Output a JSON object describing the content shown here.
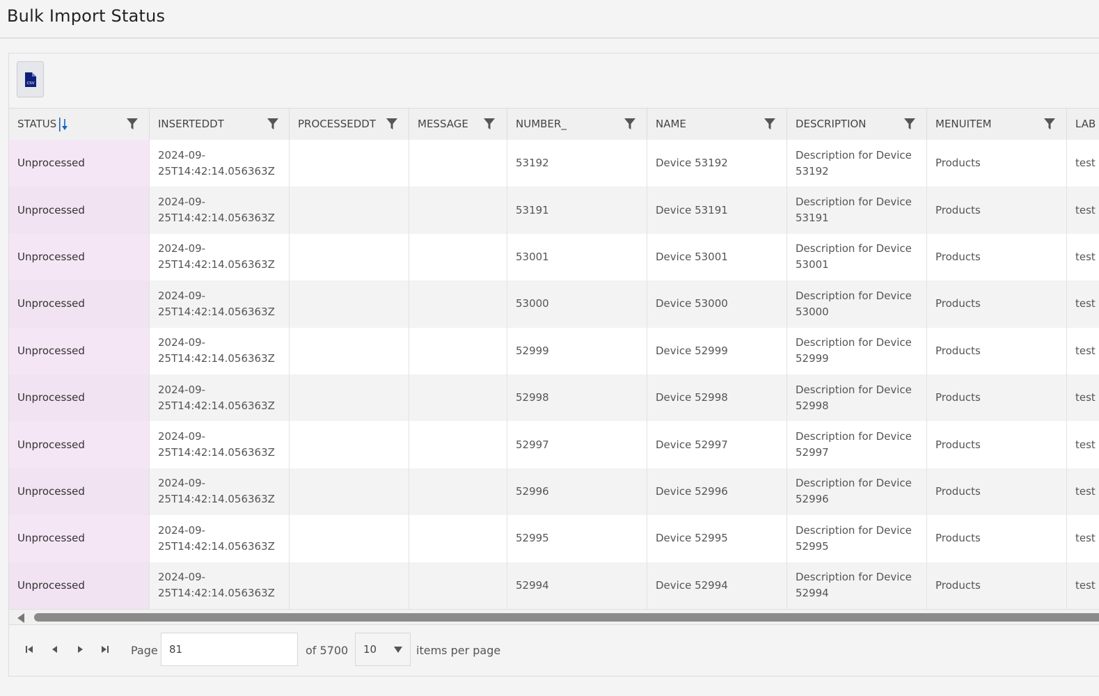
{
  "page": {
    "title": "Bulk Import Status"
  },
  "toolbar": {
    "export_icon": "csv-file-icon",
    "export_icon_text": "CSV"
  },
  "columns": [
    {
      "key": "status",
      "label": "STATUS",
      "sorted": "descending"
    },
    {
      "key": "inserteddt",
      "label": "INSERTEDDT"
    },
    {
      "key": "processeddt",
      "label": "PROCESSEDDT"
    },
    {
      "key": "message",
      "label": "MESSAGE"
    },
    {
      "key": "number",
      "label": "NUMBER_"
    },
    {
      "key": "name",
      "label": "NAME"
    },
    {
      "key": "description",
      "label": "DESCRIPTION"
    },
    {
      "key": "menuitem",
      "label": "MENUITEM"
    },
    {
      "key": "label",
      "label": "LAB"
    }
  ],
  "rows": [
    {
      "status": "Unprocessed",
      "inserteddt": "2024-09-\n25T14:42:14.056363Z",
      "processeddt": "",
      "message": "",
      "number": "53192",
      "name": "Device 53192",
      "description": "Description for Device\n53192",
      "menuitem": "Products",
      "label": "test"
    },
    {
      "status": "Unprocessed",
      "inserteddt": "2024-09-\n25T14:42:14.056363Z",
      "processeddt": "",
      "message": "",
      "number": "53191",
      "name": "Device 53191",
      "description": "Description for Device\n53191",
      "menuitem": "Products",
      "label": "test"
    },
    {
      "status": "Unprocessed",
      "inserteddt": "2024-09-\n25T14:42:14.056363Z",
      "processeddt": "",
      "message": "",
      "number": "53001",
      "name": "Device 53001",
      "description": "Description for Device\n53001",
      "menuitem": "Products",
      "label": "test"
    },
    {
      "status": "Unprocessed",
      "inserteddt": "2024-09-\n25T14:42:14.056363Z",
      "processeddt": "",
      "message": "",
      "number": "53000",
      "name": "Device 53000",
      "description": "Description for Device\n53000",
      "menuitem": "Products",
      "label": "test"
    },
    {
      "status": "Unprocessed",
      "inserteddt": "2024-09-\n25T14:42:14.056363Z",
      "processeddt": "",
      "message": "",
      "number": "52999",
      "name": "Device 52999",
      "description": "Description for Device\n52999",
      "menuitem": "Products",
      "label": "test"
    },
    {
      "status": "Unprocessed",
      "inserteddt": "2024-09-\n25T14:42:14.056363Z",
      "processeddt": "",
      "message": "",
      "number": "52998",
      "name": "Device 52998",
      "description": "Description for Device\n52998",
      "menuitem": "Products",
      "label": "test"
    },
    {
      "status": "Unprocessed",
      "inserteddt": "2024-09-\n25T14:42:14.056363Z",
      "processeddt": "",
      "message": "",
      "number": "52997",
      "name": "Device 52997",
      "description": "Description for Device\n52997",
      "menuitem": "Products",
      "label": "test"
    },
    {
      "status": "Unprocessed",
      "inserteddt": "2024-09-\n25T14:42:14.056363Z",
      "processeddt": "",
      "message": "",
      "number": "52996",
      "name": "Device 52996",
      "description": "Description for Device\n52996",
      "menuitem": "Products",
      "label": "test"
    },
    {
      "status": "Unprocessed",
      "inserteddt": "2024-09-\n25T14:42:14.056363Z",
      "processeddt": "",
      "message": "",
      "number": "52995",
      "name": "Device 52995",
      "description": "Description for Device\n52995",
      "menuitem": "Products",
      "label": "test"
    },
    {
      "status": "Unprocessed",
      "inserteddt": "2024-09-\n25T14:42:14.056363Z",
      "processeddt": "",
      "message": "",
      "number": "52994",
      "name": "Device 52994",
      "description": "Description for Device\n52994",
      "menuitem": "Products",
      "label": "test"
    }
  ],
  "pager": {
    "page_label": "Page",
    "current_page": "81",
    "of_label": "of 5700",
    "page_size": "10",
    "items_per_page_label": "items per page"
  },
  "colors": {
    "status_column_bg": "#f5e6f6",
    "sort_arrow": "#1565c0",
    "csv_icon": "#0d1f7a"
  }
}
